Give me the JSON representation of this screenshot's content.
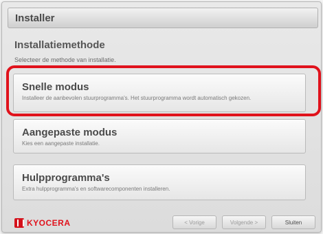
{
  "window": {
    "title": "Installer"
  },
  "page": {
    "heading": "Installatiemethode",
    "subheading": "Selecteer de methode van installatie."
  },
  "options": [
    {
      "title": "Snelle modus",
      "description": "Installeer de aanbevolen stuurprogramma's. Het stuurprogramma wordt automatisch gekozen."
    },
    {
      "title": "Aangepaste modus",
      "description": "Kies een aangepaste installatie."
    },
    {
      "title": "Hulpprogramma's",
      "description": "Extra hulpprogramma's en softwarecomponenten installeren."
    }
  ],
  "footer": {
    "brand": "KYOCERA",
    "back_label": "< Vorige",
    "next_label": "Volgende >",
    "close_label": "Sluiten"
  },
  "colors": {
    "highlight": "#e0121c",
    "brand": "#d4121c"
  }
}
